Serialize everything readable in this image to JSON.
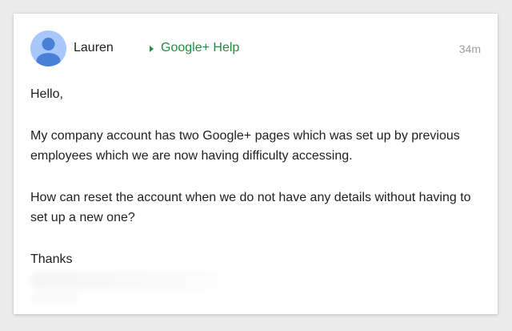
{
  "post": {
    "author": "Lauren",
    "community": "Google+ Help",
    "timestamp": "34m",
    "greeting": "Hello,",
    "paragraph1": "My company account has two Google+ pages which was set up by previous employees which we are now having difficulty accessing.",
    "paragraph2": "How can reset the account when we do not have any details without having to set up a new one?",
    "signoff": "Thanks"
  },
  "icons": {
    "avatar": "default-person-avatar",
    "community_arrow": "triangle-right-icon"
  },
  "colors": {
    "community_link": "#1e8e3e",
    "avatar_bg": "#a8c7fa",
    "avatar_figure": "#4a7fd6",
    "timestamp": "#9e9e9e"
  }
}
